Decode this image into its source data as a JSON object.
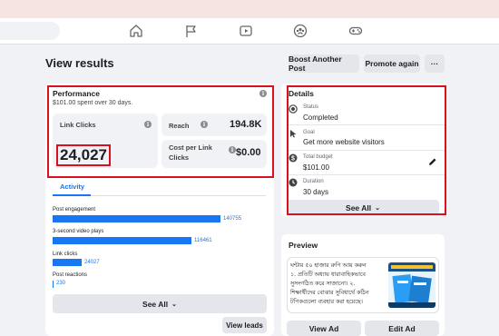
{
  "page": {
    "title": "View results"
  },
  "header_buttons": {
    "boost": "Boost Another Post",
    "promote": "Promote again",
    "more": "···"
  },
  "nav_icons": [
    "home-icon",
    "flag-icon",
    "video-icon",
    "groups-icon",
    "gaming-icon"
  ],
  "performance": {
    "title": "Performance",
    "subtitle": "$101.00 spent over 30 days.",
    "link_clicks": {
      "label": "Link Clicks",
      "value": "24,027"
    },
    "reach": {
      "label": "Reach",
      "value": "194.8K"
    },
    "cost_per_link_click": {
      "label_line1": "Cost per Link",
      "label_line2": "Clicks",
      "value": "$0.00"
    }
  },
  "activity": {
    "tab": "Activity",
    "rows": [
      {
        "label": "Post engagement",
        "value": 140755,
        "display": "140755"
      },
      {
        "label": "3-second video plays",
        "value": 116461,
        "display": "116461"
      },
      {
        "label": "Link clicks",
        "value": 24027,
        "display": "24027"
      },
      {
        "label": "Post reactions",
        "value": 230,
        "display": "230"
      }
    ],
    "see_all": "See All",
    "view_leads": "View leads"
  },
  "details": {
    "title": "Details",
    "items": [
      {
        "label": "Status",
        "value": "Completed",
        "icon": "status-icon"
      },
      {
        "label": "Goal",
        "value": "Get more website visitors",
        "icon": "cursor-icon"
      },
      {
        "label": "Total budget",
        "value": "$101.00",
        "icon": "dollar-icon"
      },
      {
        "label": "Duration",
        "value": "30 days",
        "icon": "clock-icon"
      }
    ],
    "see_all": "See All",
    "edit_icon": "pencil-icon"
  },
  "preview": {
    "title": "Preview",
    "text_lines": [
      "ঘন্টায় ৫০ হাজার রুপি আয় করুন",
      "১. প্রতিটি অধ্যায় ধারাবাহিকভাবে",
      "সুসংগঠিত করে সাজানো। ২.",
      "শিক্ষার্থীদের বোঝার সুবিধার্থে কঠিন",
      "টপিকগুলো ব্যবহার করা হয়েছে।"
    ],
    "view_ad": "View Ad",
    "edit_ad": "Edit Ad"
  },
  "colors": {
    "accent": "#1877f2",
    "highlight": "#d9101e"
  }
}
